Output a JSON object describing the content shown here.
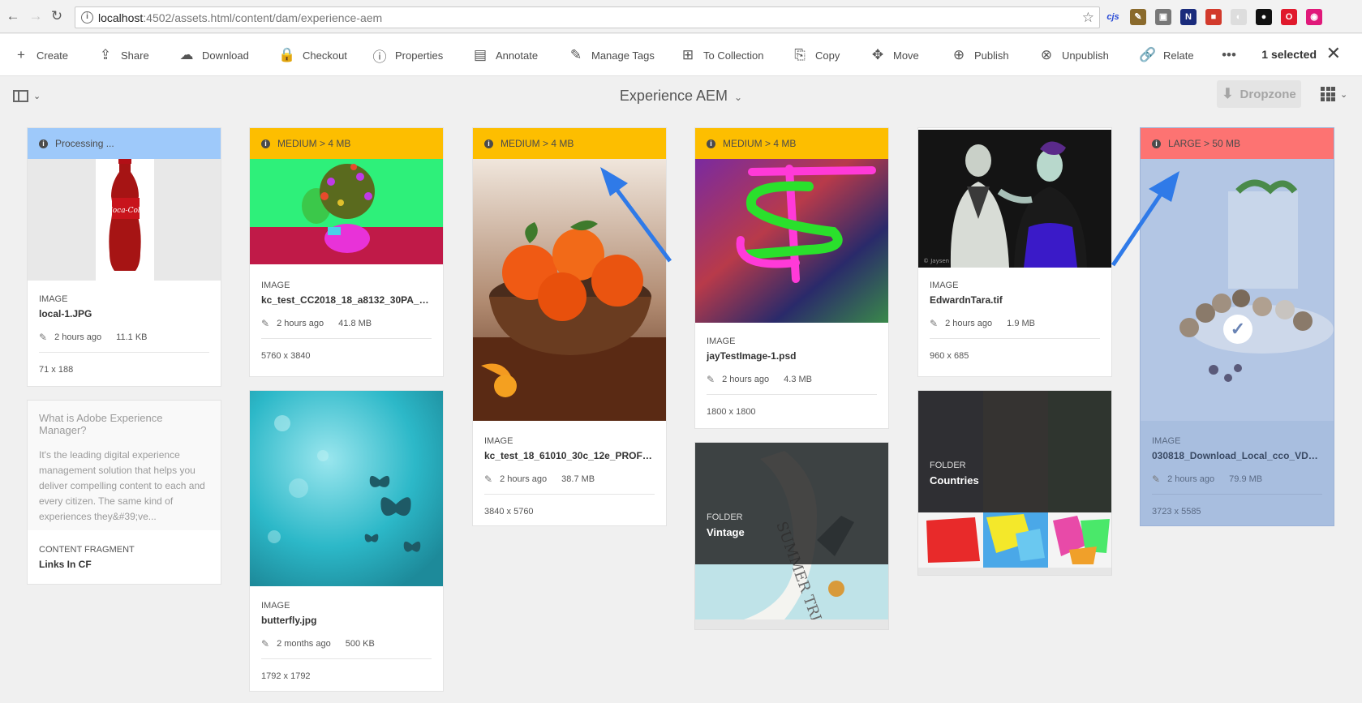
{
  "browser": {
    "url_host": "localhost",
    "url_rest": ":4502/assets.html/content/dam/experience-aem",
    "extensions": [
      {
        "name": "cjs-icon",
        "label": "cjs",
        "color": "#2a4bd6"
      },
      {
        "name": "pen-icon",
        "label": "✎",
        "color": "#8a6a2c"
      },
      {
        "name": "square-ext-icon",
        "label": "▣",
        "color": "#777777"
      },
      {
        "name": "n-ext-icon",
        "label": "N",
        "color": "#1a2b7c"
      },
      {
        "name": "colorful-ext-icon",
        "label": "■",
        "color": "#d23a2c"
      },
      {
        "name": "moon-ext-icon",
        "label": "◐",
        "color": "#dddddd"
      },
      {
        "name": "spy-ext-icon",
        "label": "●",
        "color": "#111111"
      },
      {
        "name": "opera-ext-icon",
        "label": "O",
        "color": "#e0192c"
      },
      {
        "name": "eye-ext-icon",
        "label": "◉",
        "color": "#e0197a"
      }
    ]
  },
  "actions": [
    {
      "name": "create",
      "label": "Create",
      "icon": "+"
    },
    {
      "name": "share",
      "label": "Share",
      "icon": "⇪"
    },
    {
      "name": "download",
      "label": "Download",
      "icon": "☁"
    },
    {
      "name": "checkout",
      "label": "Checkout",
      "icon": "🔒"
    },
    {
      "name": "properties",
      "label": "Properties",
      "icon": "ⓘ"
    },
    {
      "name": "annotate",
      "label": "Annotate",
      "icon": "▤"
    },
    {
      "name": "manage-tags",
      "label": "Manage Tags",
      "icon": "✎"
    },
    {
      "name": "to-collection",
      "label": "To Collection",
      "icon": "⊞"
    },
    {
      "name": "copy",
      "label": "Copy",
      "icon": "⎘"
    },
    {
      "name": "move",
      "label": "Move",
      "icon": "✥"
    },
    {
      "name": "publish",
      "label": "Publish",
      "icon": "⊕"
    },
    {
      "name": "unpublish",
      "label": "Unpublish",
      "icon": "⊗"
    },
    {
      "name": "relate",
      "label": "Relate",
      "icon": "🔗"
    }
  ],
  "more_icon": "•••",
  "selected_label": "1 selected",
  "title": "Experience AEM",
  "dropzone_label": "Dropzone",
  "cards": {
    "processing_label": "Processing ...",
    "medium_label": "MEDIUM > 4 MB",
    "large_label": "LARGE > 50 MB",
    "local": {
      "type": "IMAGE",
      "name": "local-1.JPG",
      "modified": "2 hours ago",
      "size": "11.1 KB",
      "dims": "71 x 188"
    },
    "kc2018": {
      "type": "IMAGE",
      "name": "kc_test_CC2018_18_a8132_30PA_01...",
      "modified": "2 hours ago",
      "size": "41.8 MB",
      "dims": "5760 x 3840"
    },
    "kc18": {
      "type": "IMAGE",
      "name": "kc_test_18_61010_30c_12e_PROFILE...",
      "modified": "2 hours ago",
      "size": "38.7 MB",
      "dims": "3840 x 5760"
    },
    "jay": {
      "type": "IMAGE",
      "name": "jayTestImage-1.psd",
      "modified": "2 hours ago",
      "size": "4.3 MB",
      "dims": "1800 x 1800"
    },
    "edward": {
      "type": "IMAGE",
      "name": "EdwardnTara.tif",
      "modified": "2 hours ago",
      "size": "1.9 MB",
      "dims": "960 x 685"
    },
    "download": {
      "type": "IMAGE",
      "name": "030818_Download_Local_cco_VDY1...",
      "modified": "2 hours ago",
      "size": "79.9 MB",
      "dims": "3723 x 5585"
    },
    "butterfly": {
      "type": "IMAGE",
      "name": "butterfly.jpg",
      "modified": "2 months ago",
      "size": "500 KB",
      "dims": "1792 x 1792"
    },
    "cf": {
      "title": "What is Adobe Experience Manager?",
      "body": "It's the leading digital experience management solution that helps you deliver compelling content to each and every citizen. The same kind of experiences they&#39;ve...",
      "type": "CONTENT FRAGMENT",
      "name": "Links In CF"
    },
    "vintage": {
      "type": "FOLDER",
      "name": "Vintage"
    },
    "countries": {
      "type": "FOLDER",
      "name": "Countries"
    }
  },
  "colors": {
    "processing": "#9ec9fa",
    "medium": "#fdbe00",
    "large": "#fd7372",
    "selected": "#a8bedf",
    "arrow": "#2f7ae8"
  }
}
